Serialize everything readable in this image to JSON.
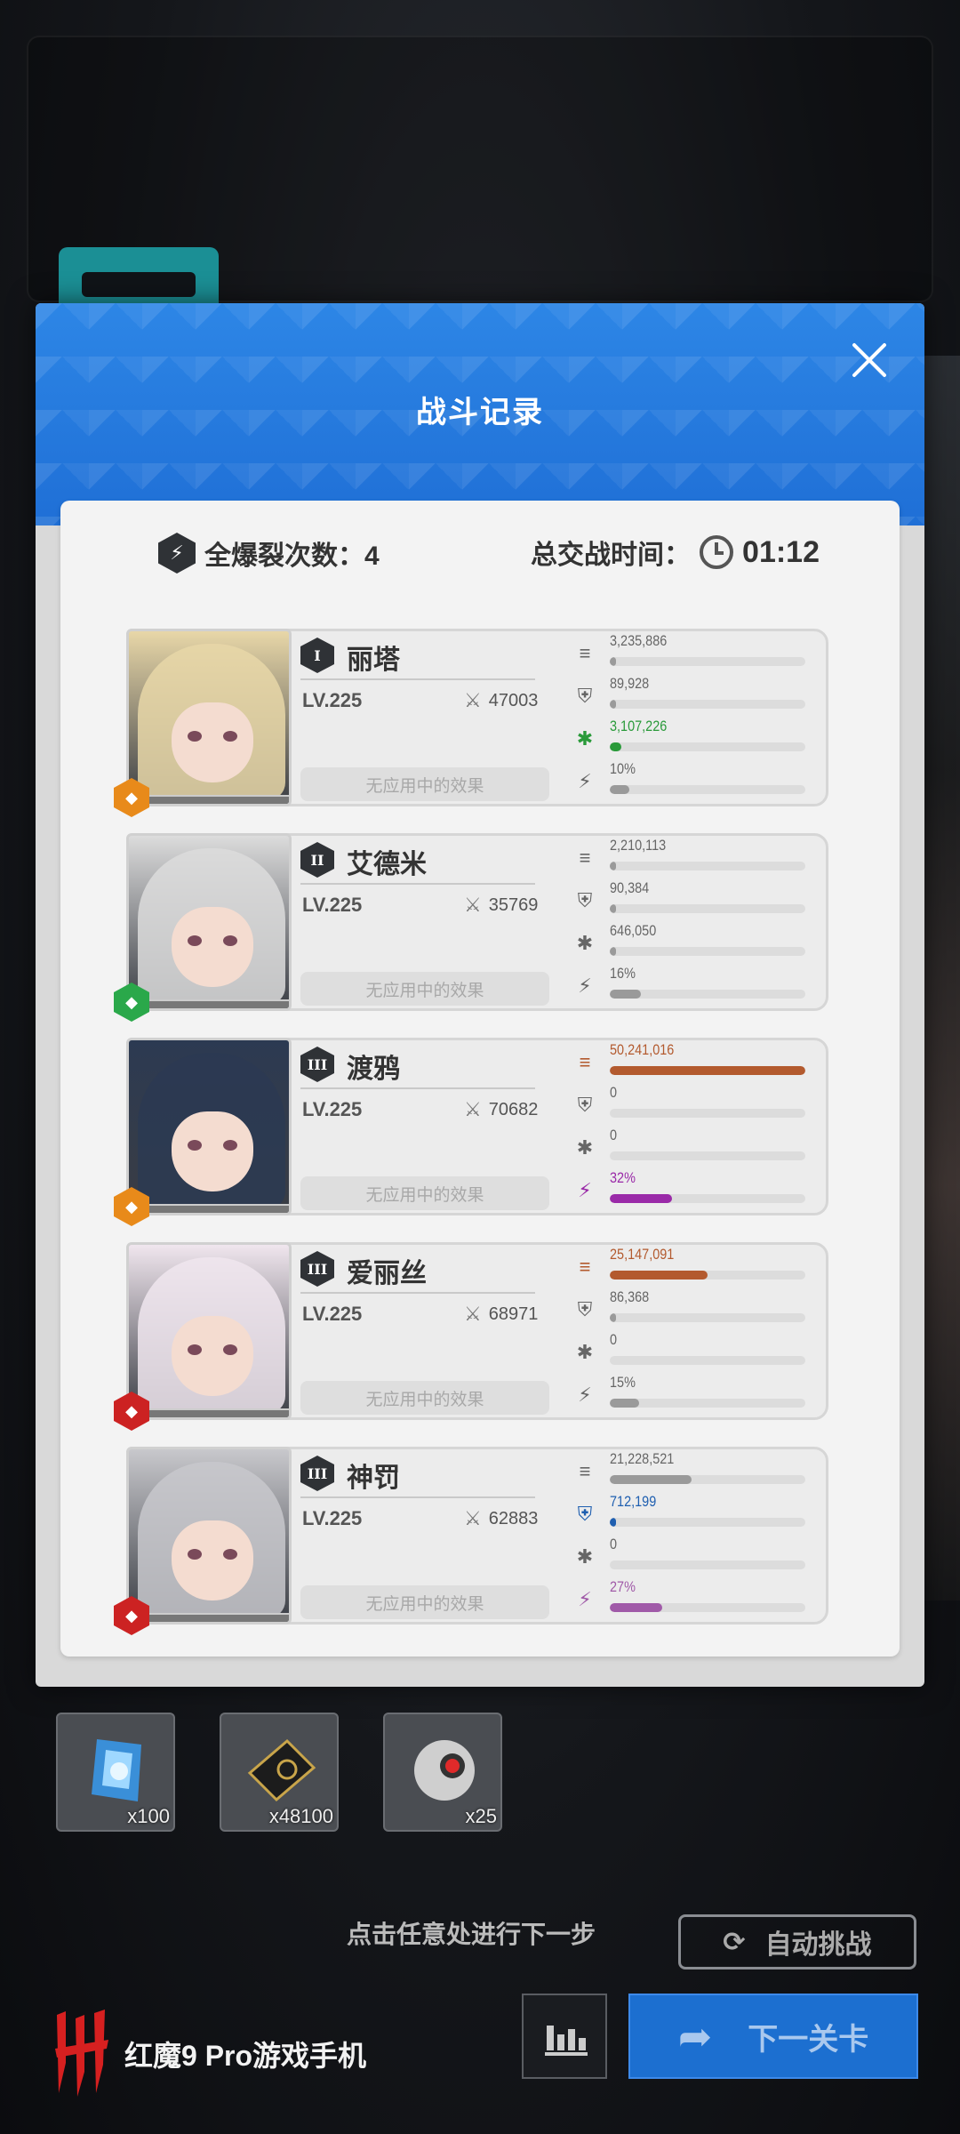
{
  "dialog": {
    "title": "战斗记录",
    "burst_label": "全爆裂次数：4",
    "battle_time_label": "总交战时间：",
    "battle_time_value": "01:12"
  },
  "characters": [
    {
      "name": "丽塔",
      "rank": "I",
      "level": "LV.225",
      "power": "47003",
      "effects": "无应用中的效果",
      "element_color": "#e88a1a",
      "hair_color": "#e8d7a8",
      "stats": {
        "damage": "3,235,886",
        "damage_ratio": 0.03,
        "damage_color": "#9a9a9a",
        "shield": "89,928",
        "shield_ratio": 0.01,
        "shield_color": "#9a9a9a",
        "heal": "3,107,226",
        "heal_ratio": 0.06,
        "heal_color": "#2a9a3a",
        "burst": "10%",
        "burst_ratio": 0.1,
        "burst_color": "#9a9a9a"
      }
    },
    {
      "name": "艾德米",
      "rank": "II",
      "level": "LV.225",
      "power": "35769",
      "effects": "无应用中的效果",
      "element_color": "#2aa84a",
      "hair_color": "#dcdcdc",
      "stats": {
        "damage": "2,210,113",
        "damage_ratio": 0.03,
        "damage_color": "#9a9a9a",
        "shield": "90,384",
        "shield_ratio": 0.01,
        "shield_color": "#9a9a9a",
        "heal": "646,050",
        "heal_ratio": 0.01,
        "heal_color": "#9a9a9a",
        "burst": "16%",
        "burst_ratio": 0.16,
        "burst_color": "#9a9a9a"
      }
    },
    {
      "name": "渡鸦",
      "rank": "III",
      "level": "LV.225",
      "power": "70682",
      "effects": "无应用中的效果",
      "element_color": "#e88a1a",
      "hair_color": "#2c3a52",
      "stats": {
        "damage": "50,241,016",
        "damage_ratio": 1.0,
        "damage_color": "#b35a2e",
        "shield": "0",
        "shield_ratio": 0,
        "shield_color": "#9a9a9a",
        "heal": "0",
        "heal_ratio": 0,
        "heal_color": "#9a9a9a",
        "burst": "32%",
        "burst_ratio": 0.32,
        "burst_color": "#9a2aa8"
      }
    },
    {
      "name": "爱丽丝",
      "rank": "III",
      "level": "LV.225",
      "power": "68971",
      "effects": "无应用中的效果",
      "element_color": "#cc2222",
      "hair_color": "#f0e6ee",
      "stats": {
        "damage": "25,147,091",
        "damage_ratio": 0.5,
        "damage_color": "#b35a2e",
        "shield": "86,368",
        "shield_ratio": 0.01,
        "shield_color": "#9a9a9a",
        "heal": "0",
        "heal_ratio": 0,
        "heal_color": "#9a9a9a",
        "burst": "15%",
        "burst_ratio": 0.15,
        "burst_color": "#9a9a9a"
      }
    },
    {
      "name": "神罚",
      "rank": "III",
      "level": "LV.225",
      "power": "62883",
      "effects": "无应用中的效果",
      "element_color": "#cc2222",
      "hair_color": "#c8c8cc",
      "stats": {
        "damage": "21,228,521",
        "damage_ratio": 0.42,
        "damage_color": "#9a9a9a",
        "shield": "712,199",
        "shield_ratio": 0.01,
        "shield_color": "#1f5fb0",
        "heal": "0",
        "heal_ratio": 0,
        "heal_color": "#9a9a9a",
        "burst": "27%",
        "burst_ratio": 0.27,
        "burst_color": "#a05aa8"
      }
    }
  ],
  "rewards": [
    {
      "icon": "crystal-icon",
      "qty": "x100"
    },
    {
      "icon": "credit-card-icon",
      "qty": "x48100"
    },
    {
      "icon": "core-sphere-icon",
      "qty": "x25"
    }
  ],
  "footer": {
    "hint": "点击任意处进行下一步",
    "auto_label": "自动挑战",
    "next_label": "下一关卡",
    "brand": "红魔9 Pro游戏手机"
  }
}
